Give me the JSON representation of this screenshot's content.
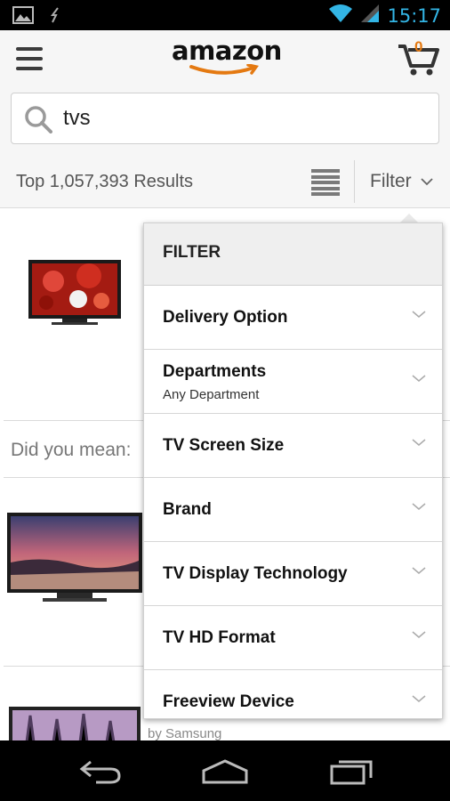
{
  "status_bar": {
    "time": "15:17"
  },
  "header": {
    "logo_text": "amazon",
    "cart_count": "0"
  },
  "search": {
    "query": "tvs"
  },
  "results_bar": {
    "results_text": "Top 1,057,393 Results",
    "filter_label": "Filter"
  },
  "content": {
    "did_you_mean": "Did you mean:",
    "byline": "by Samsung"
  },
  "filter": {
    "title": "FILTER",
    "items": [
      {
        "label": "Delivery Option",
        "sub": ""
      },
      {
        "label": "Departments",
        "sub": "Any Department"
      },
      {
        "label": "TV Screen Size",
        "sub": ""
      },
      {
        "label": "Brand",
        "sub": ""
      },
      {
        "label": "TV Display Technology",
        "sub": ""
      },
      {
        "label": "TV HD Format",
        "sub": ""
      },
      {
        "label": "Freeview Device",
        "sub": ""
      }
    ]
  },
  "colors": {
    "accent": "#e47911",
    "status_time": "#33b5e5"
  }
}
